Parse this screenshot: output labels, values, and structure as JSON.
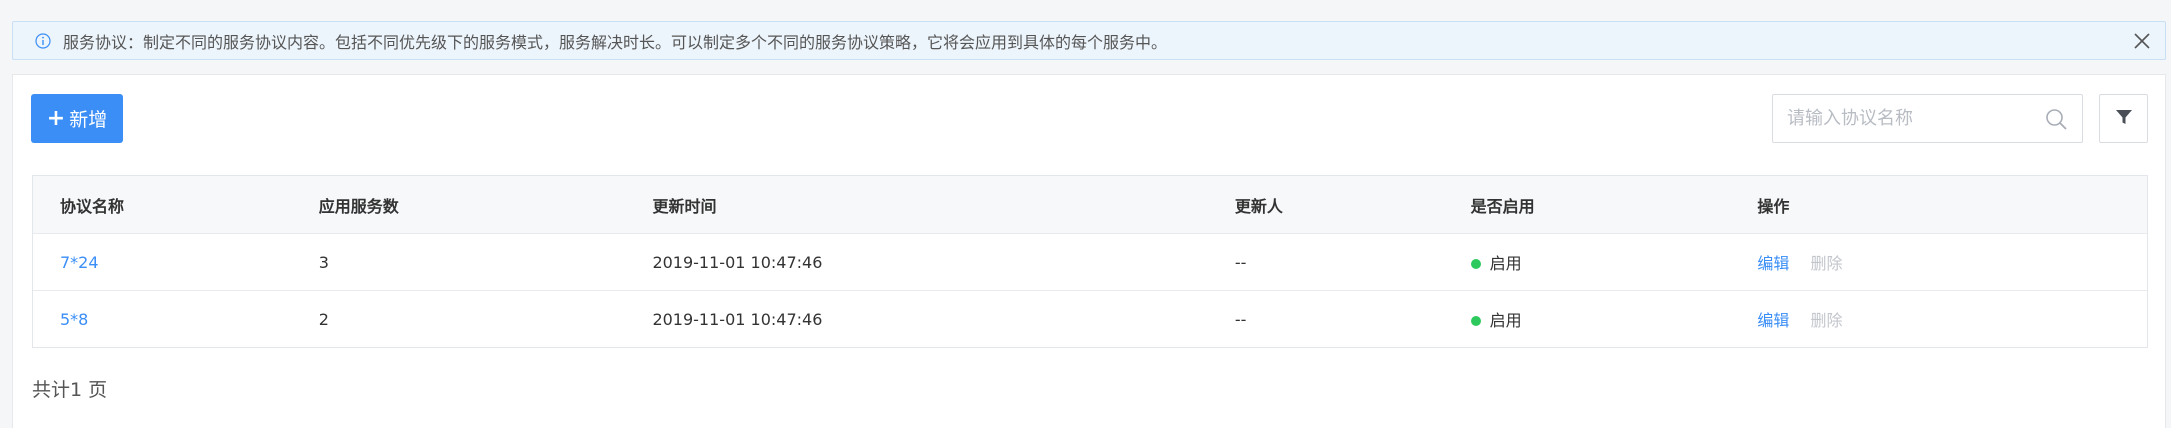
{
  "notice": {
    "text": "服务协议：制定不同的服务协议内容。包括不同优先级下的服务模式，服务解决时长。可以制定多个不同的服务协议策略，它将会应用到具体的每个服务中。"
  },
  "toolbar": {
    "add_label": "新增",
    "search_placeholder": "请输入协议名称",
    "search_value": ""
  },
  "table": {
    "columns": [
      "协议名称",
      "应用服务数",
      "更新时间",
      "更新人",
      "是否启用",
      "操作"
    ],
    "rows": [
      {
        "name": "7*24",
        "service_count": "3",
        "updated_at": "2019-11-01 10:47:46",
        "updated_by": "--",
        "status": "启用",
        "edit": "编辑",
        "delete": "删除"
      },
      {
        "name": "5*8",
        "service_count": "2",
        "updated_at": "2019-11-01 10:47:46",
        "updated_by": "--",
        "status": "启用",
        "edit": "编辑",
        "delete": "删除"
      }
    ]
  },
  "pagination": {
    "summary": "共计1 页"
  },
  "colors": {
    "primary": "#3a8ef6",
    "status_enabled": "#2ec95c",
    "notice_bg": "#edf5fc",
    "delete_disabled": "#c2c6cc"
  }
}
